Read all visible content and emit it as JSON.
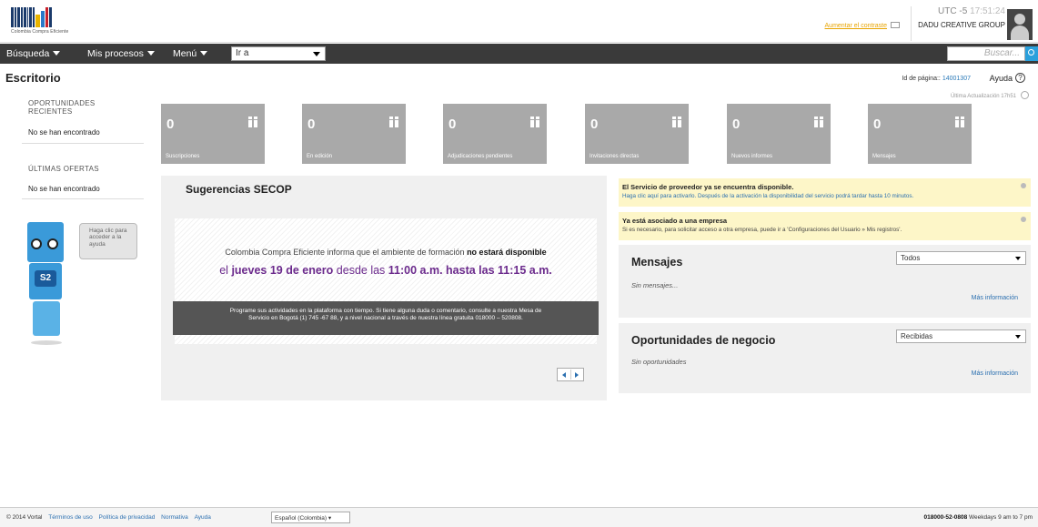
{
  "header": {
    "logo_caption": "Colombia Compra Eficiente",
    "contrast_link": "Aumentar el contraste",
    "timezone": "UTC -5",
    "time": "17:51:24",
    "organization": "DADU CREATIVE GROUP"
  },
  "nav": {
    "items": [
      {
        "label": "Búsqueda"
      },
      {
        "label": "Mis procesos"
      },
      {
        "label": "Menú"
      }
    ],
    "goto_value": "Ir a",
    "search_placeholder": "Buscar..."
  },
  "page": {
    "title": "Escritorio",
    "page_id_label": "Id de página::",
    "page_id": "14001307",
    "help_label": "Ayuda",
    "help_icon": "?",
    "last_update": "Última Actualización 17h51"
  },
  "sidebar": {
    "opportunities_title": "OPORTUNIDADES RECIENTES",
    "opportunities_empty": "No se han encontrado",
    "offers_title": "ÚLTIMAS OFERTAS",
    "offers_empty": "No se han encontrado",
    "mascot_bubble": "Haga clic para acceder a la ayuda",
    "mascot_badge": "S2"
  },
  "tiles": [
    {
      "count": "0",
      "label": "Suscripciones"
    },
    {
      "count": "0",
      "label": "En edición"
    },
    {
      "count": "0",
      "label": "Adjudicaciones pendientes"
    },
    {
      "count": "0",
      "label": "Invitaciones directas"
    },
    {
      "count": "0",
      "label": "Nuevos informes"
    },
    {
      "count": "0",
      "label": "Mensajes"
    }
  ],
  "suggestions": {
    "title": "Sugerencias SECOP",
    "line1_pre": "Colombia Compra Eficiente informa que el ambiente de formación",
    "line1_bold": "no estará disponible",
    "line2_pre": "el",
    "line2_date": "jueves 19 de enero",
    "line2_mid": "desde las",
    "line2_time": "11:00 a.m. hasta las 11:15 a.m.",
    "dark_text_1": "Programe sus actividades en la plataforma con tiempo. Si tiene alguna duda o comentario, consulte a nuestra Mesa de",
    "dark_text_2": "Servicio en Bogotá (1) 745 -67 88, y a nivel nacional a través de nuestra línea gratuita 018000 – 520808."
  },
  "notices": [
    {
      "title": "El Servicio de proveedor ya se encuentra disponible.",
      "text": "Haga clic aquí para activarlo. Después de la activación la disponibilidad del servicio podrá tardar hasta 10 minutos."
    },
    {
      "title": "Ya está asociado a una empresa",
      "text": "Si es necesario, para solicitar acceso a otra empresa, puede ir a 'Configuraciones del Usuario » Mis registros'."
    }
  ],
  "messages": {
    "title": "Mensajes",
    "filter": "Todos",
    "empty": "Sin mensajes...",
    "more": "Más información"
  },
  "business": {
    "title": "Oportunidades de negocio",
    "filter": "Recibidas",
    "empty": "Sin oportunidades",
    "more": "Más información"
  },
  "footer": {
    "copyright": "© 2014 Vortal",
    "links": [
      "Términos de uso",
      "Política de privacidad",
      "Normativa",
      "Ayuda"
    ],
    "language": "Español (Colombia)",
    "phone": "018000-52-0808",
    "hours": "Weekdays 9 am to 7 pm"
  }
}
